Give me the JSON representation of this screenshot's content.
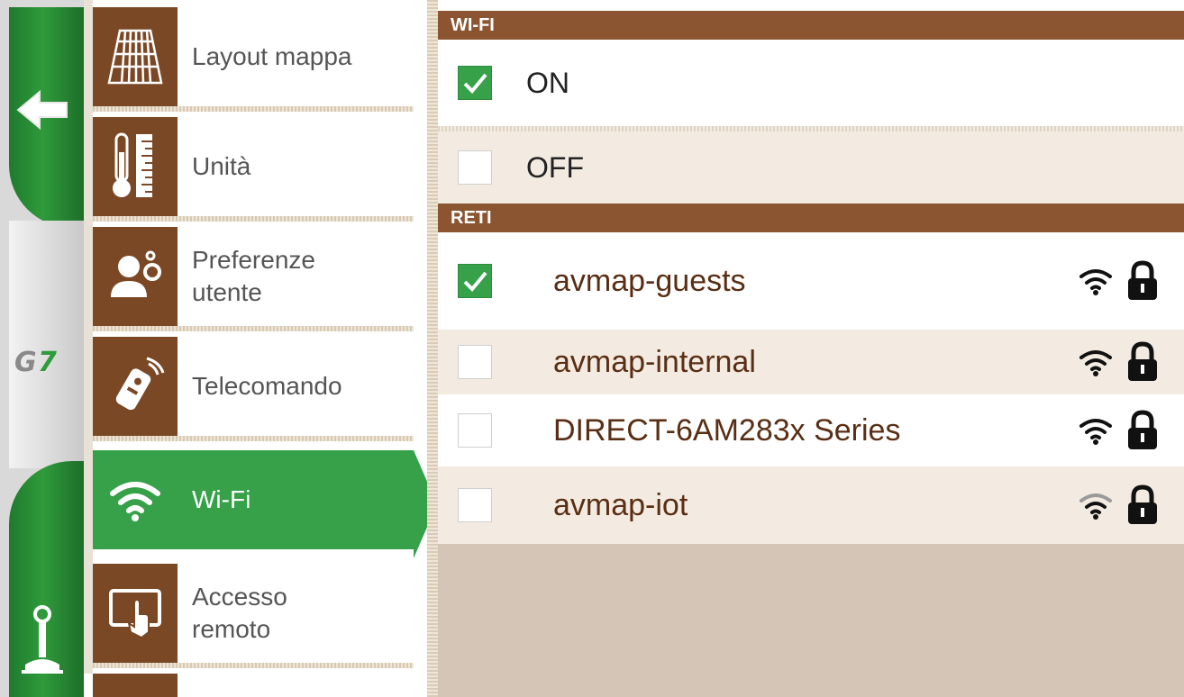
{
  "sidebar": {
    "back_icon": "back-arrow-icon",
    "logo_text": "G7",
    "bottom_icon": "joystick-icon"
  },
  "menu": {
    "items": [
      {
        "label": "Layout mappa",
        "icon": "map-layout-icon"
      },
      {
        "label": "Unità",
        "icon": "thermometer-ruler-icon"
      },
      {
        "label": "Preferenze\nutente",
        "icon": "user-settings-icon"
      },
      {
        "label": "Telecomando",
        "icon": "remote-control-icon"
      },
      {
        "label": "Wi-Fi",
        "icon": "wifi-icon",
        "selected": true
      },
      {
        "label": "Accesso\nremoto",
        "icon": "remote-access-icon"
      }
    ]
  },
  "wifi_section": {
    "header": "WI-FI",
    "options": [
      {
        "label": "ON",
        "checked": true
      },
      {
        "label": "OFF",
        "checked": false
      }
    ]
  },
  "networks_section": {
    "header": "RETI",
    "networks": [
      {
        "name": "avmap-guests",
        "checked": true,
        "secured": true
      },
      {
        "name": "avmap-internal",
        "checked": false,
        "secured": true
      },
      {
        "name": "DIRECT-6AM283x Series",
        "checked": false,
        "secured": true
      },
      {
        "name": "avmap-iot",
        "checked": false,
        "secured": true
      }
    ]
  },
  "colors": {
    "accent_green": "#36a148",
    "brown": "#7b4826",
    "header_brown": "#8a5530",
    "network_text": "#5a2e14"
  }
}
